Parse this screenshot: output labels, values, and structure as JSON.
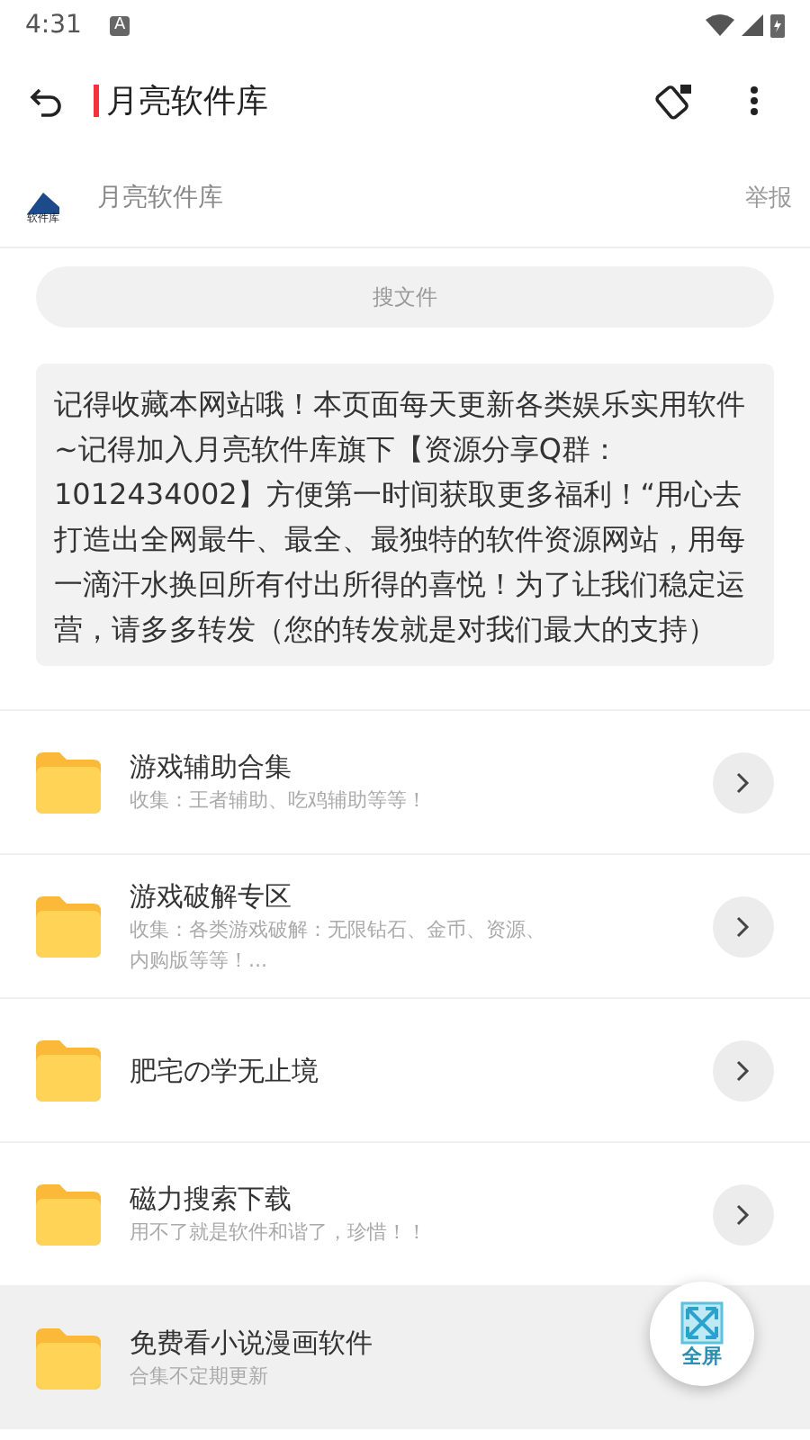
{
  "status_bar": {
    "time": "4:31",
    "notification": "A"
  },
  "app_bar": {
    "title": "月亮软件库"
  },
  "author": {
    "name": "月亮软件库",
    "logo_text": "软件库",
    "report": "举报"
  },
  "search": {
    "placeholder": "搜文件"
  },
  "notice": "记得收藏本网站哦！本页面每天更新各类娱乐实用软件~记得加入月亮软件库旗下【资源分享Q群：1012434002】方便第一时间获取更多福利！“用心去打造出全网最牛、最全、最独特的软件资源网站，用每一滴汗水换回所有付出所得的喜悦！为了让我们稳定运营，请多多转发（您的转发就是对我们最大的支持）",
  "folders": [
    {
      "title": "游戏辅助合集",
      "subtitle": "收集：王者辅助、吃鸡辅助等等！",
      "selected": false,
      "arrow_visible": true
    },
    {
      "title": "游戏破解专区",
      "subtitle": "收集：各类游戏破解：无限钻石、金币、资源、内购版等等！...",
      "selected": false,
      "arrow_visible": true
    },
    {
      "title": "肥宅の学无止境",
      "selected": false,
      "arrow_visible": true
    },
    {
      "title": "磁力搜索下载",
      "subtitle": "用不了就是软件和谐了，珍惜！！",
      "selected": false,
      "arrow_visible": true
    },
    {
      "title": "免费看小说漫画软件",
      "subtitle": "合集不定期更新",
      "selected": true,
      "arrow_visible": false
    }
  ],
  "fab": {
    "label": "全屏"
  }
}
